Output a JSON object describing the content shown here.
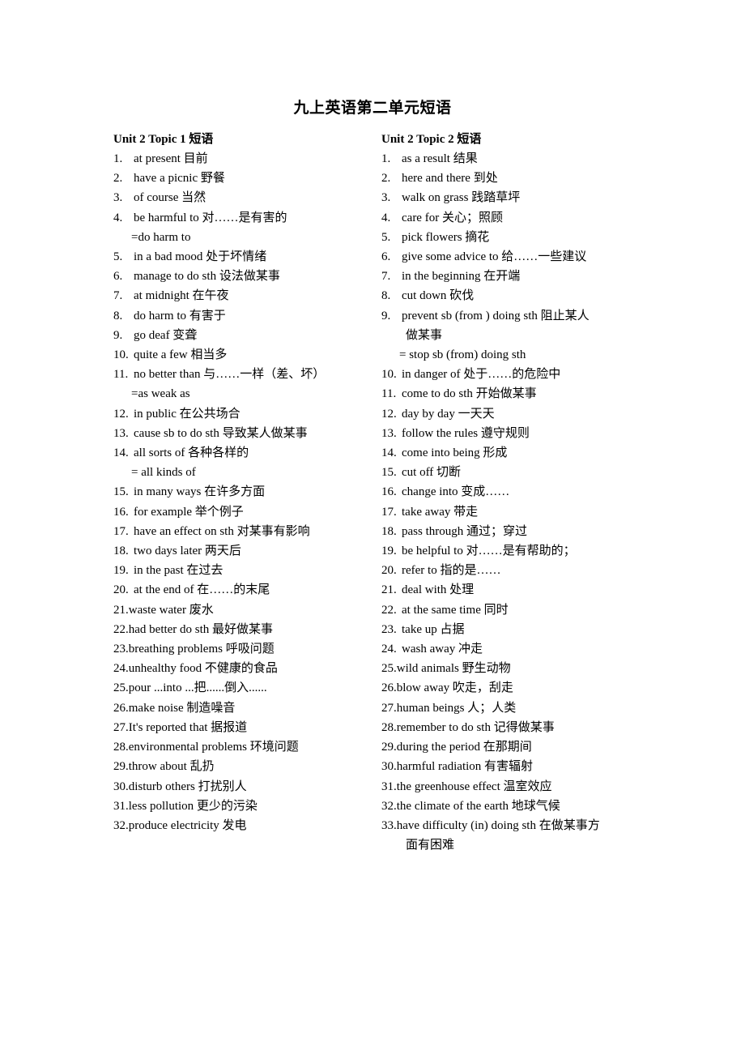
{
  "document": {
    "title": "九上英语第二单元短语"
  },
  "columns": [
    {
      "heading": "Unit 2 Topic 1 短语",
      "items": [
        {
          "num": "1.",
          "text": "at    present    目前",
          "tight": false
        },
        {
          "num": "2.",
          "text": "have a    picnic    野餐",
          "tight": false
        },
        {
          "num": "3.",
          "text": "of    course    当然",
          "tight": false
        },
        {
          "num": "4.",
          "text": "be    harmful to    对……是有害的",
          "tight": false,
          "sub": [
            {
              "text": "=do harm to",
              "style": "eq"
            }
          ]
        },
        {
          "num": "5.",
          "text": "in a    bad mood    处于坏情绪",
          "tight": false
        },
        {
          "num": "6.",
          "text": "manage    to do sth    设法做某事",
          "tight": false
        },
        {
          "num": "7.",
          "text": "at midnight    在午夜",
          "tight": false
        },
        {
          "num": "8.",
          "text": "do harm to    有害于",
          "tight": false
        },
        {
          "num": "9.",
          "text": "go deaf    变聋",
          "tight": false
        },
        {
          "num": "10.",
          "text": "quite a few    相当多",
          "tight": false
        },
        {
          "num": "11.",
          "text": "no better than    与……一样（差、坏）",
          "tight": false,
          "sub": [
            {
              "text": "=as weak as",
              "style": "eq"
            }
          ]
        },
        {
          "num": "12.",
          "text": "in public    在公共场合",
          "tight": false
        },
        {
          "num": "13.",
          "text": "cause sb    to do sth    导致某人做某事",
          "tight": false
        },
        {
          "num": "14.",
          "text": "all    sorts    of    各种各样的",
          "tight": false,
          "sub": [
            {
              "text": "= all kinds    of",
              "style": "eq"
            }
          ]
        },
        {
          "num": "15.",
          "text": "in many ways    在许多方面",
          "tight": false
        },
        {
          "num": "16.",
          "text": "for example    举个例子",
          "tight": false
        },
        {
          "num": "17.",
          "text": "have an effect on sth    对某事有影响",
          "tight": false
        },
        {
          "num": "18.",
          "text": "two days later    两天后",
          "tight": false
        },
        {
          "num": "19.",
          "text": "in the past    在过去",
          "tight": false
        },
        {
          "num": "20.",
          "text": "at the end of    在……的末尾",
          "tight": false
        },
        {
          "num": "21.",
          "text": "waste    water 废水",
          "tight": true
        },
        {
          "num": "22.",
          "text": "had    better do    sth 最好做某事",
          "tight": true
        },
        {
          "num": "23.",
          "text": "breathing problems 呼吸问题",
          "tight": true
        },
        {
          "num": "24.",
          "text": "unhealthy food 不健康的食品",
          "tight": true
        },
        {
          "num": "25.",
          "text": "pour ...into ...把......倒入......",
          "tight": true
        },
        {
          "num": "26.",
          "text": "make noise 制造噪音",
          "tight": true
        },
        {
          "num": "27.",
          "text": "It's    reported that 据报道",
          "tight": true
        },
        {
          "num": "28.",
          "text": "environmental problems  环境问题",
          "tight": true
        },
        {
          "num": "29.",
          "text": "throw about  乱扔",
          "tight": true
        },
        {
          "num": "30.",
          "text": "disturb others  打扰别人",
          "tight": true
        },
        {
          "num": "31.",
          "text": "less pollution 更少的污染",
          "tight": true
        },
        {
          "num": "32.",
          "text": "produce electricity  发电",
          "tight": true
        }
      ]
    },
    {
      "heading": "Unit 2 Topic 2 短语",
      "items": [
        {
          "num": "1.",
          "text": "as a result    结果",
          "tight": false
        },
        {
          "num": "2.",
          "text": "here and there    到处",
          "tight": false
        },
        {
          "num": "3.",
          "text": "walk on grass    践踏草坪",
          "tight": false
        },
        {
          "num": "4.",
          "text": "care for    关心；照顾",
          "tight": false
        },
        {
          "num": "5.",
          "text": "pick flowers    摘花",
          "tight": false
        },
        {
          "num": "6.",
          "text": "give some advice to    给……一些建议",
          "tight": false
        },
        {
          "num": "7.",
          "text": "in the beginning    在开端",
          "tight": false
        },
        {
          "num": "8.",
          "text": "cut down    砍伐",
          "tight": false
        },
        {
          "num": "9.",
          "text": "prevent sb (from ) doing sth    阻止某人",
          "tight": false,
          "sub": [
            {
              "text": "做某事",
              "style": "wide"
            },
            {
              "text": "= stop sb (from) doing sth",
              "style": "eq"
            }
          ]
        },
        {
          "num": "10.",
          "text": "in danger of    处于……的危险中",
          "tight": false
        },
        {
          "num": "11.",
          "text": "come to do sth    开始做某事",
          "tight": false
        },
        {
          "num": "12.",
          "text": "day    by    day    一天天",
          "tight": false
        },
        {
          "num": "13.",
          "text": "follow    the rules    遵守规则",
          "tight": false
        },
        {
          "num": "14.",
          "text": "come into being    形成",
          "tight": false
        },
        {
          "num": "15.",
          "text": "cut    off    切断",
          "tight": false
        },
        {
          "num": "16.",
          "text": "change    into    变成……",
          "tight": false
        },
        {
          "num": "17.",
          "text": "take    away    带走",
          "tight": false
        },
        {
          "num": "18.",
          "text": "pass    through    通过；穿过",
          "tight": false
        },
        {
          "num": "19.",
          "text": "be helpful to    对……是有帮助的；",
          "tight": false
        },
        {
          "num": "20.",
          "text": "refer    to    指的是……",
          "tight": false
        },
        {
          "num": "21.",
          "text": "deal    with    处理",
          "tight": false
        },
        {
          "num": "22.",
          "text": "at    the    same    time    同时",
          "tight": false
        },
        {
          "num": "23.",
          "text": "take    up    占据",
          "tight": false
        },
        {
          "num": "24.",
          "text": "wash    away    冲走",
          "tight": false
        },
        {
          "num": "25.",
          "text": "wild animals  野生动物",
          "tight": true
        },
        {
          "num": "26.",
          "text": "blow away    吹走，刮走",
          "tight": true
        },
        {
          "num": "27.",
          "text": "human beings  人；人类",
          "tight": true
        },
        {
          "num": "28.",
          "text": "remember to do sth  记得做某事",
          "tight": true
        },
        {
          "num": "29.",
          "text": "during the period  在那期间",
          "tight": true
        },
        {
          "num": "30.",
          "text": "harmful radiation    有害辐射",
          "tight": true
        },
        {
          "num": "31.",
          "text": "the greenhouse effect    温室效应",
          "tight": true
        },
        {
          "num": "32.",
          "text": "the climate of the earth 地球气候",
          "tight": true
        },
        {
          "num": "33.",
          "text": "have difficulty (in) doing sth    在做某事方",
          "tight": true,
          "sub": [
            {
              "text": "面有困难",
              "style": "wide"
            }
          ]
        }
      ]
    }
  ]
}
